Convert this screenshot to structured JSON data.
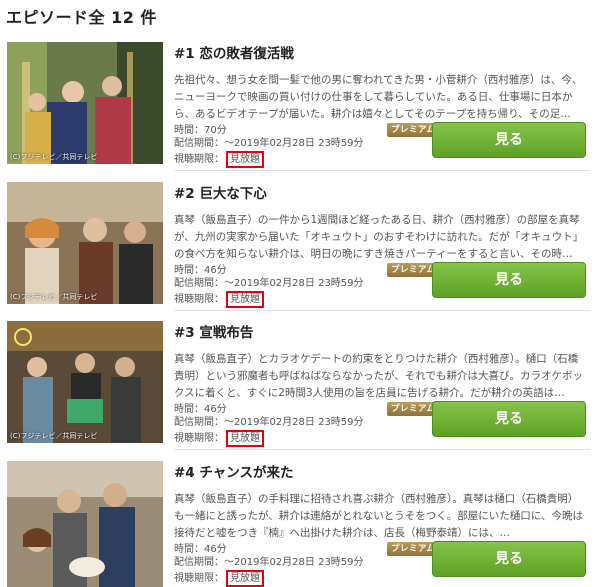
{
  "header": {
    "title": "エピソード全 12 件"
  },
  "episodes": [
    {
      "title": "#1 恋の敗者復活戦",
      "description": "先祖代々、想う女を間一髪で他の男に奪われてきた男・小菅耕介（西村雅彦）は、今、ニューヨークで映画の買い付けの仕事をして暮らしていた。ある日、仕事場に日本から、あるビデオテープが届いた。耕介は嬉々としてそのテープを持ち帰り、その足…",
      "time": "時間：70分",
      "period": "配信期間：～2019年02月28日 23時59分",
      "view_label": "視聴期限：",
      "view_badge": "見放題",
      "premium": "プレミアム",
      "button": "見る",
      "copyright": "(C)フジテレビ／共同テレビ"
    },
    {
      "title": "#2 巨大な下心",
      "description": "真琴（飯島直子）の一件から1週間ほど経ったある日、耕介（西村雅彦）の部屋を真琴が、九州の実家から届いた「オキュウト」のおすそわけに訪れた。だが「オキュウト」の食べ方を知らない耕介は、明日の晩にすき焼きパーティーをすると言い、その時…",
      "time": "時間：46分",
      "period": "配信期間：～2019年02月28日 23時59分",
      "view_label": "視聴期限：",
      "view_badge": "見放題",
      "premium": "プレミアム",
      "button": "見る",
      "copyright": "(C)フジテレビ／共同テレビ"
    },
    {
      "title": "#3 宣戦布告",
      "description": "真琴（飯島直子）とカラオケデートの約束をとりつけた耕介（西村雅彦）。樋口（石橋貴明）という邪魔者も呼ばねばならなかったが、それでも耕介は大喜び。カラオケボックスに着くと、すぐに2時間3人使用の旨を店員に告げる耕介。だが耕介の英語は…",
      "time": "時間：46分",
      "period": "配信期間：～2019年02月28日 23時59分",
      "view_label": "視聴期限：",
      "view_badge": "見放題",
      "premium": "プレミアム",
      "button": "見る",
      "copyright": "(C)フジテレビ／共同テレビ"
    },
    {
      "title": "#4 チャンスが来た",
      "description": "真琴（飯島直子）の手料理に招待され喜ぶ耕介（西村雅彦）。真琴は樋口（石橋貴明）も一緒にと誘ったが、耕介は連絡がとれないとうそをつく。部屋にいた樋口に、今晩は接待だと嘘をつき『楠』へ出掛けた耕介は、店長（梅野泰靖）には、…",
      "time": "時間：46分",
      "period": "配信期間：～2019年02月28日 23時59分",
      "view_label": "視聴期限：",
      "view_badge": "見放題",
      "premium": "プレミアム",
      "button": "見る",
      "copyright": ""
    }
  ]
}
